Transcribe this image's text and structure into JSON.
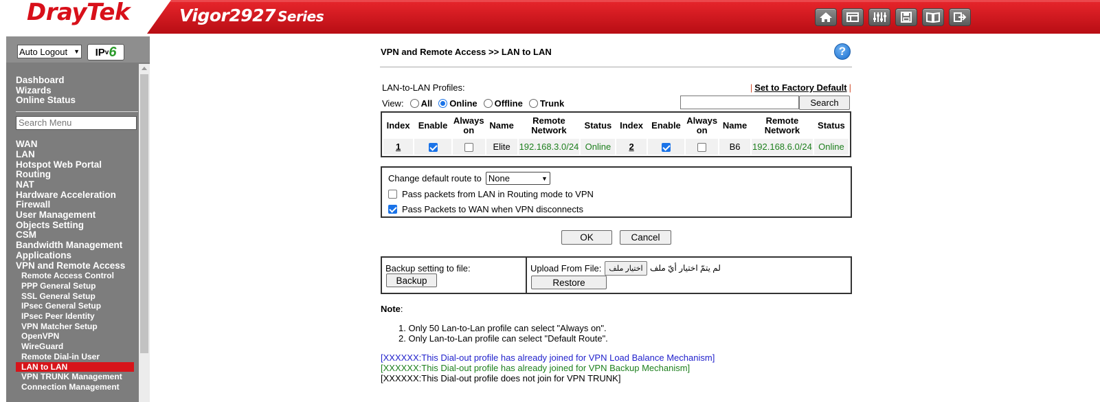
{
  "header": {
    "brand": "DrayTek",
    "model": "Vigor2927",
    "series": "Series",
    "icons": [
      "home-icon",
      "quick-start-icon",
      "settings-sliders-icon",
      "save-icon",
      "manual-book-icon",
      "logout-icon"
    ],
    "colors": {
      "red": "#d7141a",
      "gray": "#7d7d7d"
    }
  },
  "sidebar": {
    "logout_select": "Auto Logout",
    "ipv6_badge_ip": "IP",
    "ipv6_badge_v": "v",
    "ipv6_badge_six": "6",
    "top_items": [
      "Dashboard",
      "Wizards",
      "Online Status"
    ],
    "search_placeholder": "Search Menu",
    "items": [
      "WAN",
      "LAN",
      "Hotspot Web Portal",
      "Routing",
      "NAT",
      "Hardware Acceleration",
      "Firewall",
      "User Management",
      "Objects Setting",
      "CSM",
      "Bandwidth Management",
      "Applications",
      "VPN and Remote Access"
    ],
    "sub_items": [
      "Remote Access Control",
      "PPP General Setup",
      "SSL General Setup",
      "IPsec General Setup",
      "IPsec Peer Identity",
      "VPN Matcher Setup",
      "OpenVPN",
      "WireGuard",
      "Remote Dial-in User",
      "LAN to LAN",
      "VPN TRUNK Management",
      "Connection Management"
    ],
    "active_sub_item": "LAN to LAN"
  },
  "main": {
    "title": "VPN and Remote Access >> LAN to LAN",
    "help": "?",
    "profiles_label": "LAN-to-LAN Profiles:",
    "factory_sep": "|",
    "factory_link": "Set to Factory Default",
    "view_label": "View:",
    "view_options": [
      "All",
      "Online",
      "Offline",
      "Trunk"
    ],
    "view_selected": "Online",
    "search_value": "",
    "search_button": "Search",
    "table": {
      "headers": [
        "Index",
        "Enable",
        "Always on",
        "Name",
        "Remote Network",
        "Status",
        "Index",
        "Enable",
        "Always on",
        "Name",
        "Remote Network",
        "Status"
      ],
      "rows": [
        {
          "index": "1",
          "enable": true,
          "always_on": false,
          "name": "Elite",
          "remote_network": "192.168.3.0/24",
          "status": "Online",
          "index2": "2",
          "enable2": true,
          "always_on2": false,
          "name2": "B6",
          "remote_network2": "192.168.6.0/24",
          "status2": "Online"
        }
      ]
    },
    "route": {
      "label": "Change default route to",
      "value": "None",
      "pass_lan_label": "Pass packets from LAN in Routing mode to VPN",
      "pass_lan_checked": false,
      "pass_wan_label": "Pass Packets to WAN when VPN disconnects",
      "pass_wan_checked": true
    },
    "ok_button": "OK",
    "cancel_button": "Cancel",
    "backup": {
      "label": "Backup setting to file:",
      "button": "Backup",
      "upload_label": "Upload From File:",
      "file_button": "اختيار ملف",
      "file_status": "لم يتمّ اختيار أيّ ملف",
      "restore_button": "Restore"
    },
    "note_title": "Note",
    "note_colon": ":",
    "notes": [
      "Only 50 Lan-to-Lan profile can select \"Always on\".",
      "Only Lan-to-Lan profile can select \"Default Route\"."
    ],
    "legend": [
      {
        "text": "[XXXXXX:This Dial-out profile has already joined for VPN Load Balance Mechanism]",
        "color": "#2222cc"
      },
      {
        "text": "[XXXXXX:This Dial-out profile has already joined for VPN Backup Mechanism]",
        "color": "#1d7f1d"
      },
      {
        "text": "[XXXXXX:This Dial-out profile does not join for VPN TRUNK]",
        "color": "#000000"
      }
    ]
  }
}
